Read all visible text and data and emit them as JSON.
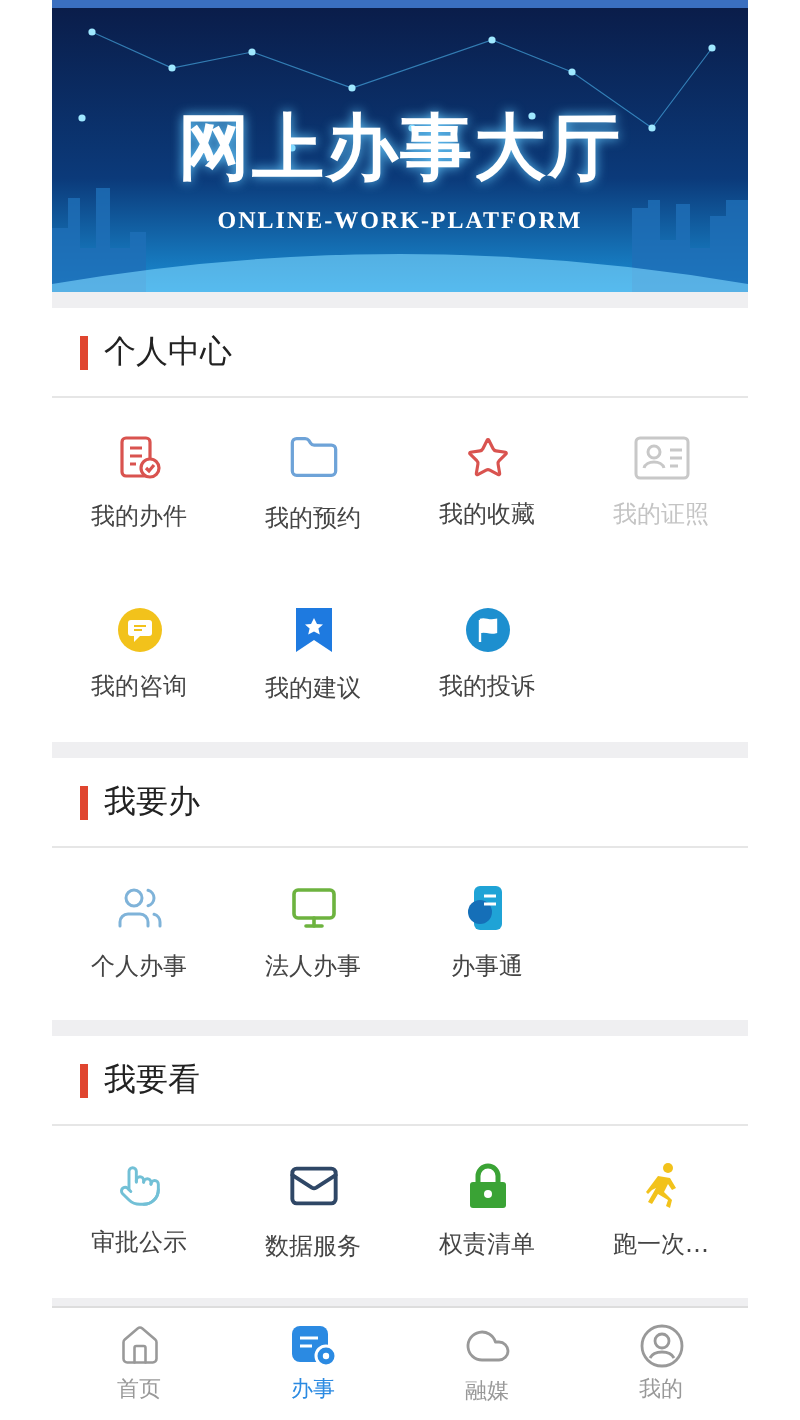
{
  "banner": {
    "title": "网上办事大厅",
    "subtitle": "ONLINE-WORK-PLATFORM"
  },
  "sections": [
    {
      "title": "个人中心",
      "items": [
        {
          "label": "我的办件",
          "disabled": false
        },
        {
          "label": "我的预约",
          "disabled": false
        },
        {
          "label": "我的收藏",
          "disabled": false
        },
        {
          "label": "我的证照",
          "disabled": true
        },
        {
          "label": "我的咨询",
          "disabled": false
        },
        {
          "label": "我的建议",
          "disabled": false
        },
        {
          "label": "我的投诉",
          "disabled": false
        }
      ]
    },
    {
      "title": "我要办",
      "items": [
        {
          "label": "个人办事",
          "disabled": false
        },
        {
          "label": "法人办事",
          "disabled": false
        },
        {
          "label": "办事通",
          "disabled": false
        }
      ]
    },
    {
      "title": "我要看",
      "items": [
        {
          "label": "审批公示",
          "disabled": false
        },
        {
          "label": "数据服务",
          "disabled": false
        },
        {
          "label": "权责清单",
          "disabled": false
        },
        {
          "label": "跑一次…",
          "disabled": false
        }
      ]
    }
  ],
  "tabs": [
    {
      "label": "首页",
      "selected": false
    },
    {
      "label": "办事",
      "selected": true
    },
    {
      "label": "融媒",
      "selected": false
    },
    {
      "label": "我的",
      "selected": false
    }
  ]
}
